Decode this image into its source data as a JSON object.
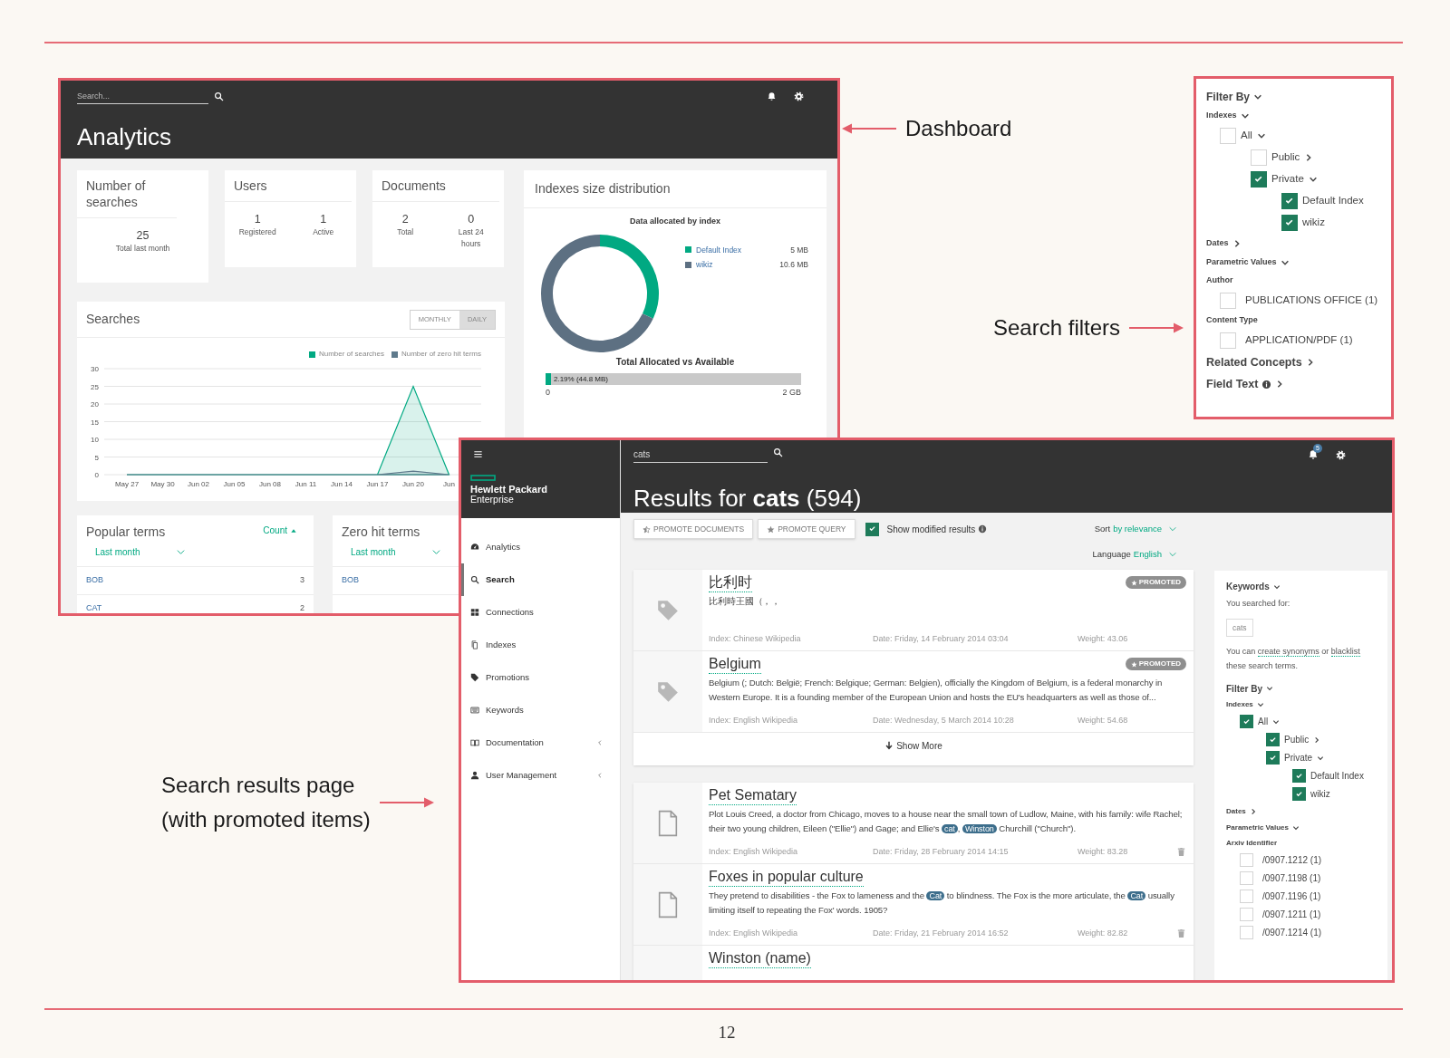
{
  "page": {
    "number": "12"
  },
  "annotations": [
    {
      "lines": [
        "Dashboard"
      ],
      "kind": "arrow-left"
    },
    {
      "lines": [
        "Search filters"
      ],
      "kind": "arrow-right"
    },
    {
      "lines": [
        "Search results page",
        "(with promoted items)"
      ],
      "kind": "arrow-right"
    }
  ],
  "dashboard": {
    "search": {
      "placeholder": "Search..."
    },
    "title": "Analytics",
    "stat_cards": [
      {
        "title": "Number of searches",
        "stats": [
          {
            "value": "25",
            "label": "Total last month"
          }
        ]
      },
      {
        "title": "Users",
        "stats": [
          {
            "value": "1",
            "label": "Registered"
          },
          {
            "value": "1",
            "label": "Active"
          }
        ]
      },
      {
        "title": "Documents",
        "stats": [
          {
            "value": "2",
            "label": "Total"
          },
          {
            "value": "0",
            "label": "Last 24 hours"
          }
        ]
      }
    ],
    "searches": {
      "title": "Searches",
      "toggle": [
        {
          "label": "MONTHLY",
          "selected": false
        },
        {
          "label": "DAILY",
          "selected": true
        }
      ],
      "chart_data": {
        "type": "area",
        "categories": [
          "May 27",
          "May 30",
          "Jun 02",
          "Jun 05",
          "Jun 08",
          "Jun 11",
          "Jun 14",
          "Jun 17",
          "Jun 20",
          "Jun"
        ],
        "series": [
          {
            "name": "Number of searches",
            "color": "#01a982",
            "values": [
              0,
              0,
              0,
              0,
              0,
              0,
              0,
              0,
              25,
              0
            ]
          },
          {
            "name": "Number of zero hit terms",
            "color": "#5f7a8c",
            "values": [
              0,
              0,
              0,
              0,
              0,
              0,
              0,
              0,
              1,
              0
            ]
          }
        ],
        "ylim": [
          0,
          30
        ],
        "yticks": [
          0,
          5,
          10,
          15,
          20,
          25,
          30
        ],
        "grid": true,
        "legend": "top"
      }
    },
    "indexes": {
      "title": "Indexes size distribution",
      "chart_data": {
        "type": "donut",
        "title": "Data allocated by index",
        "categories": [
          "Default Index",
          "wikiz"
        ],
        "values": [
          5,
          10.6
        ],
        "value_labels": [
          "5 MB",
          "10.6 MB"
        ],
        "legend": "right"
      },
      "usage": {
        "title": "Total Allocated vs Available",
        "label": "2.19% (44.8 MB)",
        "level": 0.0219,
        "min": "0",
        "max": "2 GB"
      }
    },
    "popular_terms": {
      "title": "Popular terms",
      "sort": "Count",
      "period": "Last month",
      "rows": [
        {
          "term": "BOB",
          "count": "3"
        },
        {
          "term": "CAT",
          "count": "2"
        }
      ]
    },
    "zero_hit_terms": {
      "title": "Zero hit terms",
      "period": "Last month",
      "rows": [
        {
          "term": "BOB"
        }
      ]
    }
  },
  "filters_panel": {
    "title": "Filter By",
    "expanded": true,
    "indexes": {
      "label": "Indexes",
      "expanded": true,
      "tree": [
        {
          "label": "All",
          "checked": false,
          "expanded": true,
          "children": [
            {
              "label": "Public",
              "checked": false,
              "expanded": false
            },
            {
              "label": "Private",
              "checked": true,
              "expanded": true,
              "children": [
                {
                  "label": "Default Index",
                  "checked": true
                },
                {
                  "label": "wikiz",
                  "checked": true
                }
              ]
            }
          ]
        }
      ]
    },
    "dates": {
      "label": "Dates",
      "expanded": false
    },
    "parametric": {
      "label": "Parametric Values",
      "expanded": true,
      "fields": [
        {
          "label": "Author",
          "values": [
            {
              "label": "PUBLICATIONS OFFICE (1)",
              "checked": false
            }
          ]
        },
        {
          "label": "Content Type",
          "values": [
            {
              "label": "APPLICATION/PDF (1)",
              "checked": false
            }
          ]
        }
      ]
    },
    "extras": [
      {
        "label": "Related Concepts",
        "expanded": false,
        "info": false
      },
      {
        "label": "Field Text",
        "expanded": false,
        "info": true
      }
    ]
  },
  "results_page": {
    "brand": {
      "name": "Hewlett Packard",
      "sub": "Enterprise"
    },
    "search": {
      "value": "cats"
    },
    "notifications": "5",
    "title": "Results for **cats** (594)",
    "nav": [
      {
        "label": "Analytics",
        "selected": false,
        "has_submenu": false
      },
      {
        "label": "Search",
        "selected": true,
        "has_submenu": false
      },
      {
        "label": "Connections",
        "selected": false,
        "has_submenu": false
      },
      {
        "label": "Indexes",
        "selected": false,
        "has_submenu": false
      },
      {
        "label": "Promotions",
        "selected": false,
        "has_submenu": false
      },
      {
        "label": "Keywords",
        "selected": false,
        "has_submenu": false
      },
      {
        "label": "Documentation",
        "selected": false,
        "has_submenu": true
      },
      {
        "label": "User Management",
        "selected": false,
        "has_submenu": true
      }
    ],
    "toolbar": {
      "buttons": [
        "PROMOTE DOCUMENTS",
        "PROMOTE QUERY"
      ],
      "show_modified": {
        "label": "Show modified results",
        "checked": true
      },
      "sort": {
        "label": "Sort",
        "value": "by relevance"
      },
      "language": {
        "label": "Language",
        "value": "English"
      }
    },
    "result_groups": [
      {
        "items": [
          {
            "kind": "promotion",
            "title": "比利时",
            "badge": "PROMOTED",
            "snippet": [
              {
                "text": "比利時王國（，，"
              }
            ],
            "index": "Index: Chinese Wikipedia",
            "date": "Date: Friday, 14 February 2014 03:04",
            "weight": "Weight: 43.06"
          },
          {
            "kind": "promotion",
            "title": "Belgium",
            "badge": "PROMOTED",
            "snippet": [
              {
                "text": "Belgium (; Dutch: België; French: Belgique; German: Belgien), officially the Kingdom of Belgium, is a federal monarchy in Western Europe. It is a founding member of the European Union and hosts the EU's headquarters as well as those of..."
              }
            ],
            "index": "Index: English Wikipedia",
            "date": "Date: Wednesday, 5 March 2014 10:28",
            "weight": "Weight: 54.68"
          }
        ],
        "show_more": "Show More"
      },
      {
        "items": [
          {
            "kind": "document",
            "title": "Pet Sematary",
            "snippet": [
              {
                "text": "Plot Louis Creed, a doctor from Chicago, moves to a house near the small town of Ludlow, Maine, with his family: wife Rachel; their two young children, Eileen (\"Ellie\") and Gage; and Ellie's "
              },
              {
                "text": "cat",
                "highlight": true
              },
              {
                "text": ", "
              },
              {
                "text": "Winston",
                "highlight": true
              },
              {
                "text": " Churchill (\"Church\")."
              }
            ],
            "index": "Index: English Wikipedia",
            "date": "Date: Friday, 28 February 2014 14:15",
            "weight": "Weight: 83.28"
          },
          {
            "kind": "document",
            "title": "Foxes in popular culture",
            "snippet": [
              {
                "text": "They pretend to disabilities - the Fox to lameness and the "
              },
              {
                "text": "Cat",
                "highlight": true
              },
              {
                "text": " to blindness. The Fox is the more articulate, the "
              },
              {
                "text": "Cat",
                "highlight": true
              },
              {
                "text": " usually limiting itself to repeating the Fox' words. 1905?"
              }
            ],
            "index": "Index: English Wikipedia",
            "date": "Date: Friday, 21 February 2014 16:52",
            "weight": "Weight: 82.82"
          },
          {
            "title": "Winston (name)"
          }
        ]
      }
    ],
    "side_panel": {
      "keywords": {
        "title": "Keywords",
        "expanded": true,
        "searched_label": "You searched for:",
        "term": "cats",
        "note": [
          {
            "text": "You can "
          },
          {
            "text": "create synonyms",
            "link": true
          },
          {
            "text": " or "
          },
          {
            "text": "blacklist",
            "link": true
          },
          {
            "text": " these search terms."
          }
        ]
      },
      "filter": {
        "title": "Filter By",
        "expanded": true,
        "indexes": {
          "label": "Indexes",
          "expanded": true,
          "tree": [
            {
              "label": "All",
              "checked": true,
              "expanded": true,
              "children": [
                {
                  "label": "Public",
                  "checked": true,
                  "expanded": false
                },
                {
                  "label": "Private",
                  "checked": true,
                  "expanded": true,
                  "children": [
                    {
                      "label": "Default Index",
                      "checked": true
                    },
                    {
                      "label": "wikiz",
                      "checked": true
                    }
                  ]
                }
              ]
            }
          ]
        },
        "dates": {
          "label": "Dates",
          "expanded": false
        },
        "parametric": {
          "label": "Parametric Values",
          "expanded": true,
          "fields": [
            {
              "label": "Arxiv Identifier",
              "values": [
                {
                  "label": "/0907.1212 (1)",
                  "checked": false
                },
                {
                  "label": "/0907.1198 (1)",
                  "checked": false
                },
                {
                  "label": "/0907.1196 (1)",
                  "checked": false
                },
                {
                  "label": "/0907.1211 (1)",
                  "checked": false
                },
                {
                  "label": "/0907.1214 (1)",
                  "checked": false
                }
              ]
            }
          ]
        }
      }
    }
  }
}
